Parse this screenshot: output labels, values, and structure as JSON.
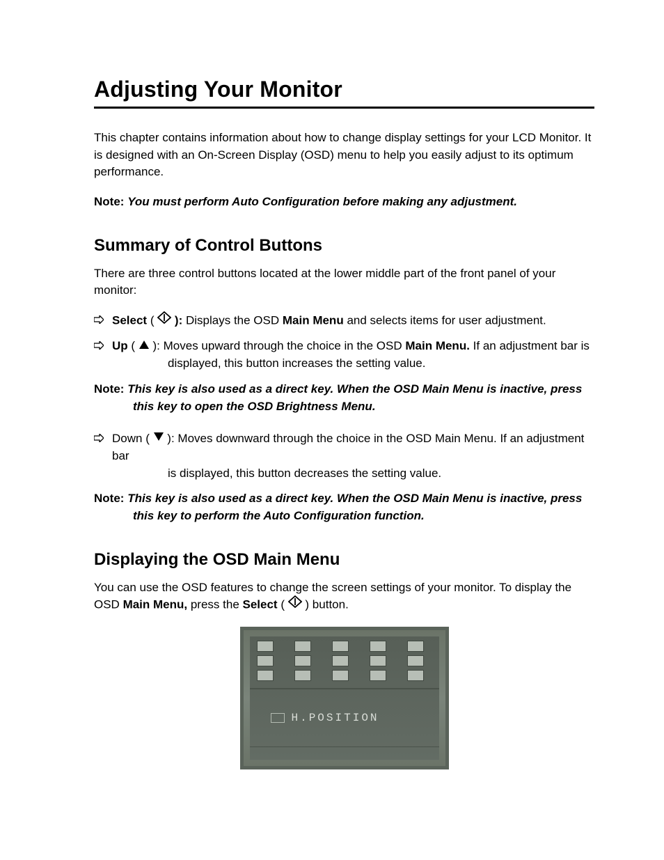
{
  "title": "Adjusting Your Monitor",
  "intro": "This chapter contains information about how to change display settings for your LCD Monitor. It is designed with an On-Screen Display (OSD) menu to help you easily adjust to its optimum performance.",
  "note1_label": "Note:",
  "note1_text": "You must perform Auto Configuration before making any adjustment.",
  "section1": "Summary of Control Buttons",
  "section1_intro": "There are three control buttons located at the lower middle part of the front panel of your monitor:",
  "bullets": {
    "select": {
      "name": "Select",
      "open": " ( ",
      "close": " ): ",
      "text_a": "Displays the OSD ",
      "bold_a": "Main Menu",
      "text_b": " and selects items for user adjustment."
    },
    "up": {
      "name": "Up",
      "open": " ( ",
      "close": " ): ",
      "text_a": "Moves upward through the choice in the OSD ",
      "bold_a": "Main Menu.",
      "text_b": "  If an adjustment bar is",
      "hang": "displayed, this button increases the setting value."
    },
    "down": {
      "name": "Down",
      "open": " ( ",
      "close": " ): ",
      "text_a": "Moves downward through the choice in the OSD Main Menu. If an adjustment bar",
      "hang": "is displayed, this button decreases the setting value."
    }
  },
  "note2_label": "Note:",
  "note2_text": "This key is also used as a direct key. When the OSD Main Menu is inactive, press this key to open the OSD Brightness Menu.",
  "note3_label": "Note:",
  "note3_text": "This key is also used as a direct key. When the OSD Main Menu is inactive, press this key to perform the Auto Configuration function.",
  "section2": "Displaying the OSD Main Menu",
  "section2_p_a": "You can use the OSD features to change the screen settings of your monitor. To display the OSD ",
  "section2_bold_a": "Main Menu,",
  "section2_p_b": " press the ",
  "section2_bold_b": "Select",
  "section2_p_c": " ( ",
  "section2_p_d": " ) button.",
  "osd": {
    "label": "H.POSITION"
  }
}
